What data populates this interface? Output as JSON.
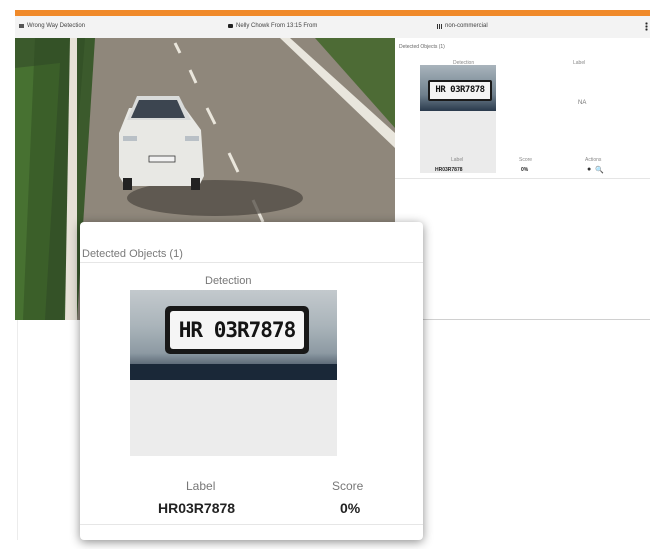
{
  "colors": {
    "accent": "#f08a2a"
  },
  "header": {
    "title": "Wrong Way Detection",
    "location": "Nelly Chowk From 13:15 From",
    "category": "non-commercial",
    "title_icon": "camera-feed-icon",
    "location_icon": "video-camera-icon",
    "category_icon": "grid-icon",
    "menu_icon": "kebab-menu-icon"
  },
  "panel": {
    "title": "Detected Objects (1)",
    "columns": {
      "detection": "Detection",
      "label_header": "Label"
    },
    "plate_text": "HR 03R7878",
    "label_value": "NA",
    "row_headers": {
      "label": "Label",
      "score": "Score",
      "actions": "Actions"
    },
    "row": {
      "label": "HR03R7878",
      "score": "0%"
    },
    "action_icons": [
      "pin-icon",
      "search-icon"
    ]
  },
  "popup": {
    "title": "Detected Objects (1)",
    "detection_header": "Detection",
    "plate_text": "HR 03R7878",
    "label_header": "Label",
    "score_header": "Score",
    "label_value": "HR03R7878",
    "score_value": "0%"
  }
}
